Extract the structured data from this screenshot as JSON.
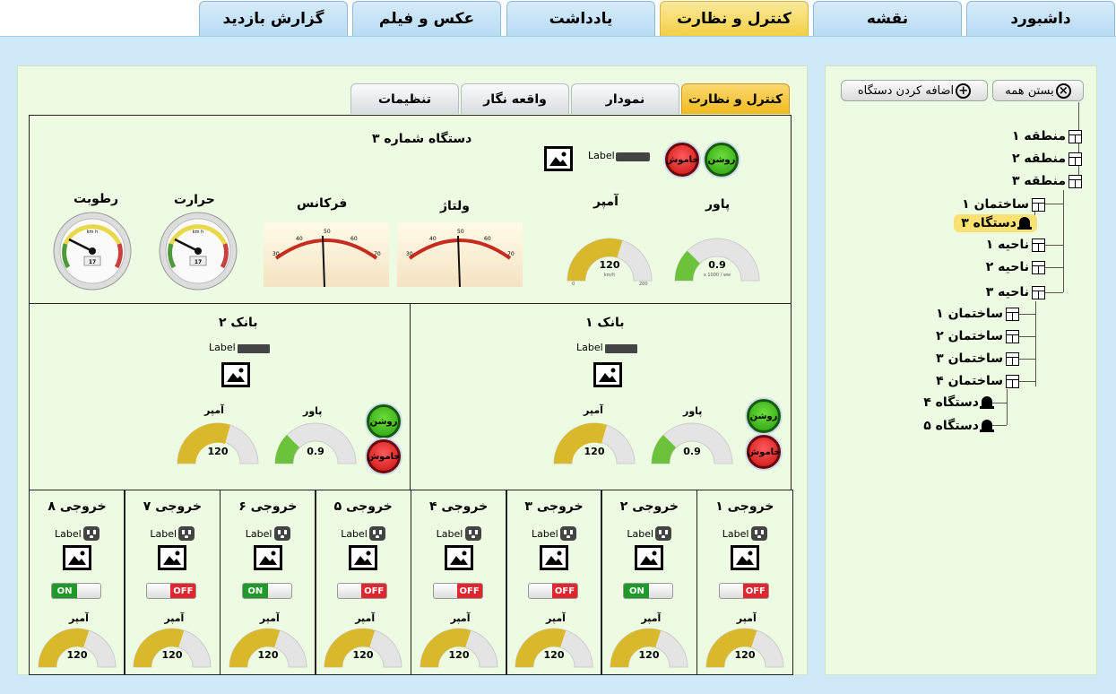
{
  "top_tabs": [
    {
      "label": "داشبورد",
      "active": false
    },
    {
      "label": "نقشه",
      "active": false
    },
    {
      "label": "کنترل و نظارت",
      "active": true
    },
    {
      "label": "یادداشت",
      "active": false
    },
    {
      "label": "عکس و فیلم",
      "active": false
    },
    {
      "label": "گزارش بازدید",
      "active": false
    }
  ],
  "sidebar": {
    "close_all": "بستن همه",
    "add_device": "اضافه کردن دستگاه",
    "tree": [
      {
        "label": "منطقه ۱",
        "type": "building"
      },
      {
        "label": "منطقه ۲",
        "type": "building"
      },
      {
        "label": "منطقه ۳",
        "type": "building"
      },
      {
        "label": "ساختمان ۱",
        "type": "building"
      },
      {
        "label": "دستگاه ۳",
        "type": "device",
        "selected": true
      },
      {
        "label": "ناحیه ۱",
        "type": "building"
      },
      {
        "label": "ناحیه ۲",
        "type": "building"
      },
      {
        "label": "ناحیه ۳",
        "type": "building"
      },
      {
        "label": "ساختمان ۱",
        "type": "building"
      },
      {
        "label": "ساختمان ۲",
        "type": "building"
      },
      {
        "label": "ساختمان ۳",
        "type": "building"
      },
      {
        "label": "ساختمان ۴",
        "type": "building"
      },
      {
        "label": "دستگاه ۴",
        "type": "device"
      },
      {
        "label": "دستگاه ۵",
        "type": "device"
      }
    ]
  },
  "sub_tabs": [
    {
      "label": "کنترل و نظارت",
      "active": true
    },
    {
      "label": "نمودار",
      "active": false
    },
    {
      "label": "واقعه نگار",
      "active": false
    },
    {
      "label": "تنظیمات",
      "active": false
    }
  ],
  "device": {
    "title": "دستگاه شماره ۳",
    "label": "Label",
    "on": "روشن",
    "off": "خاموش",
    "power_label": "پاور",
    "power_value": "0.9",
    "power_fraction": 0.25,
    "power_unit": "x 1000 / ww",
    "amp_label": "آمپر",
    "amp_value": "120",
    "amp_fraction": 0.6,
    "amp_unit": "km/h",
    "amp_min": "0",
    "amp_max": "200",
    "voltage_label": "ولتاژ",
    "frequency_label": "فرکانس",
    "temp_label": "حرارت",
    "humidity_label": "رطوبت",
    "analog_ticks": [
      "30",
      "40",
      "50",
      "60",
      "70"
    ],
    "round_value": "17",
    "round_unit": "km h"
  },
  "banks": [
    {
      "title": "بانک ۲",
      "label": "Label",
      "power_label": "پاور",
      "power_value": "0.9",
      "amp_label": "آمپر",
      "amp_value": "120",
      "on": "روشن",
      "off": "خاموش"
    },
    {
      "title": "بانک ۱",
      "label": "Label",
      "power_label": "پاور",
      "power_value": "0.9",
      "amp_label": "آمپر",
      "amp_value": "120",
      "on": "روشن",
      "off": "خاموش"
    }
  ],
  "outputs": [
    {
      "title": "خروجی ۸",
      "label": "Label",
      "state": "ON",
      "amp_label": "آمپر",
      "amp_value": "120"
    },
    {
      "title": "خروجی ۷",
      "label": "Label",
      "state": "OFF",
      "amp_label": "آمپر",
      "amp_value": "120"
    },
    {
      "title": "خروجی ۶",
      "label": "Label",
      "state": "ON",
      "amp_label": "آمپر",
      "amp_value": "120"
    },
    {
      "title": "خروجی ۵",
      "label": "Label",
      "state": "OFF",
      "amp_label": "آمپر",
      "amp_value": "120"
    },
    {
      "title": "خروجی ۴",
      "label": "Label",
      "state": "OFF",
      "amp_label": "آمپر",
      "amp_value": "120"
    },
    {
      "title": "خروجی ۳",
      "label": "Label",
      "state": "OFF",
      "amp_label": "آمپر",
      "amp_value": "120"
    },
    {
      "title": "خروجی ۲",
      "label": "Label",
      "state": "ON",
      "amp_label": "آمپر",
      "amp_value": "120"
    },
    {
      "title": "خروجی ۱",
      "label": "Label",
      "state": "OFF",
      "amp_label": "آمپر",
      "amp_value": "120"
    }
  ],
  "colors": {
    "gauge_gold": "#d9b92b",
    "gauge_green": "#6cc23a",
    "gauge_bg": "#e6e6e6"
  }
}
